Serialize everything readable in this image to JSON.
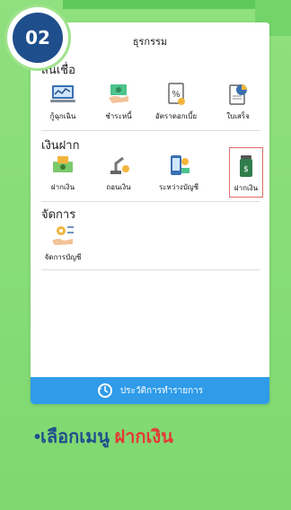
{
  "step_badge": "02",
  "header": {
    "title": "ธุรกรรม"
  },
  "sections": [
    {
      "title": "สินเชื่อ",
      "items": [
        {
          "label": "กู้ฉุกเฉิน",
          "icon": "laptop-chart-icon"
        },
        {
          "label": "ชำระหนี้",
          "icon": "hand-cash-icon"
        },
        {
          "label": "อัตราดอกเบี้ย",
          "icon": "percent-document-icon"
        },
        {
          "label": "ใบเสร็จ",
          "icon": "receipt-chart-icon"
        }
      ]
    },
    {
      "title": "เงินฝาก",
      "items": [
        {
          "label": "ฝากเงิน",
          "icon": "money-deposit-icon"
        },
        {
          "label": "ถอนเงิน",
          "icon": "robot-arm-coin-icon"
        },
        {
          "label": "ระหว่างบัญชี",
          "icon": "phone-transfer-icon"
        },
        {
          "label": "ฝากเงิน",
          "icon": "money-jar-icon",
          "highlighted": true
        }
      ]
    },
    {
      "title": "จัดการ",
      "items": [
        {
          "label": "จัดการบัญชี",
          "icon": "hand-gear-icon"
        }
      ]
    }
  ],
  "bottom_bar": {
    "label": "ประวัติการทำรายการ",
    "icon": "history-icon"
  },
  "caption": {
    "bullet": "•",
    "prefix": "เลือกเมนู ",
    "highlight": "ฝากเงิน"
  },
  "colors": {
    "accent": "#2f9be9",
    "badge": "#1f4e8c",
    "highlight": "#e53935",
    "background": "#8fe07e"
  }
}
